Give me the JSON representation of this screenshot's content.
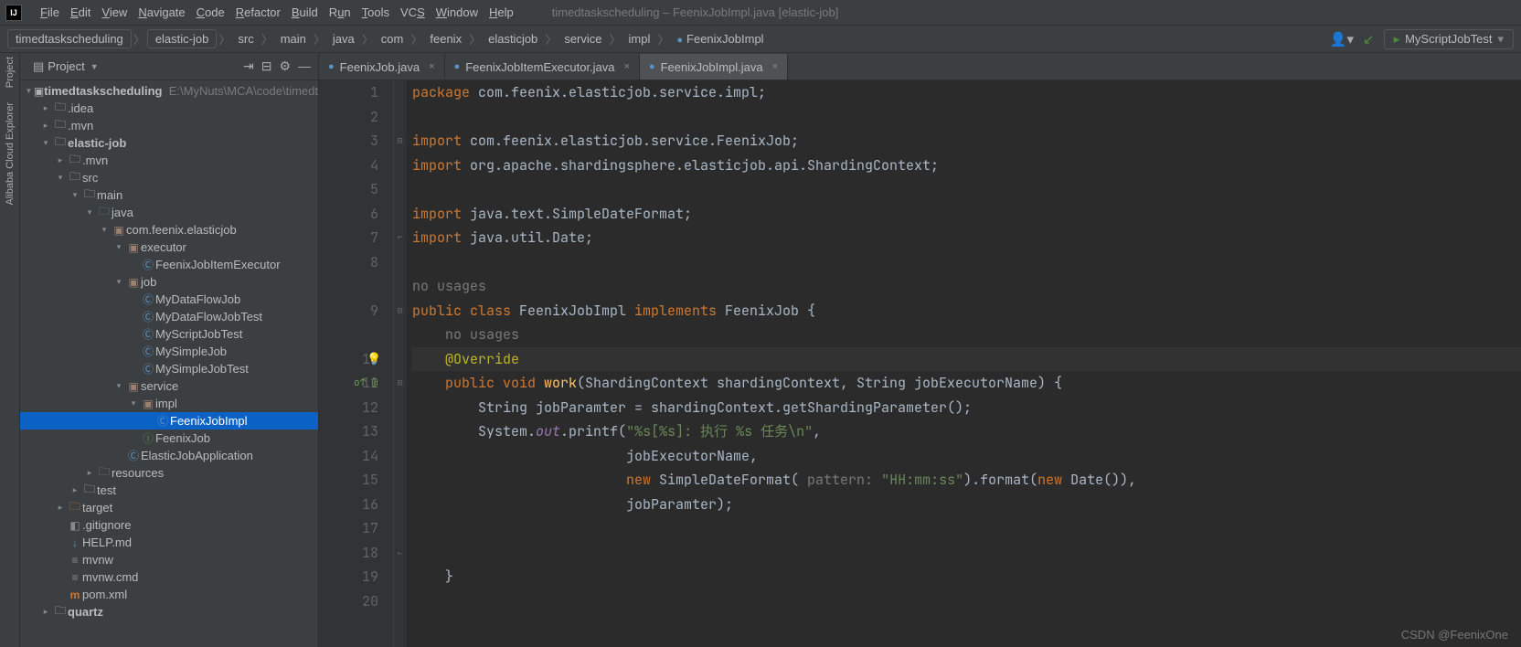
{
  "menubar": {
    "title": "timedtaskscheduling – FeenixJobImpl.java [elastic-job]",
    "items": [
      "File",
      "Edit",
      "View",
      "Navigate",
      "Code",
      "Refactor",
      "Build",
      "Run",
      "Tools",
      "VCS",
      "Window",
      "Help"
    ]
  },
  "breadcrumbs": {
    "items": [
      "timedtaskscheduling",
      "elastic-job",
      "src",
      "main",
      "java",
      "com",
      "feenix",
      "elasticjob",
      "service",
      "impl",
      "FeenixJobImpl"
    ],
    "run_config": "MyScriptJobTest"
  },
  "project_panel": {
    "title": "Project",
    "root": "timedtaskscheduling",
    "root_path": "E:\\MyNuts\\MCA\\code\\timedt",
    "tree": {
      "idea": ".idea",
      "mvn": ".mvn",
      "elastic_job": "elastic-job",
      "ej_mvn": ".mvn",
      "src": "src",
      "main": "main",
      "java": "java",
      "pkg": "com.feenix.elasticjob",
      "executor": "executor",
      "fjie": "FeenixJobItemExecutor",
      "job": "job",
      "mdfj": "MyDataFlowJob",
      "mdfjt": "MyDataFlowJobTest",
      "msjt": "MyScriptJobTest",
      "msj": "MySimpleJob",
      "msjt2": "MySimpleJobTest",
      "service": "service",
      "impl": "impl",
      "fjimpl": "FeenixJobImpl",
      "fj": "FeenixJob",
      "eja": "ElasticJobApplication",
      "res": "resources",
      "test": "test",
      "target": "target",
      "gitignore": ".gitignore",
      "help": "HELP.md",
      "mvnw": "mvnw",
      "mvnwcmd": "mvnw.cmd",
      "pom": "pom.xml",
      "quartz": "quartz"
    }
  },
  "sidebar": {
    "project": "Project",
    "explorer": "Alibaba Cloud Explorer"
  },
  "tabs": {
    "t1": "FeenixJob.java",
    "t2": "FeenixJobItemExecutor.java",
    "t3": "FeenixJobImpl.java"
  },
  "editor": {
    "line_numbers": [
      "1",
      "2",
      "3",
      "4",
      "5",
      "6",
      "7",
      "8",
      "",
      "9",
      "",
      "10",
      "11",
      "12",
      "13",
      "14",
      "15",
      "16",
      "17",
      "18",
      "19",
      "20"
    ],
    "usages_class": "no usages",
    "usages_method": "no usages",
    "l1_kw": "package ",
    "l1_rest": "com.feenix.elasticjob.service.impl;",
    "l3_kw": "import ",
    "l3_pkg_a": "com.feenix.elasticjob.service.FeenixJob;",
    "l4_kw": "import ",
    "l4_pkg": "org.apache.shardingsphere.elasticjob.api.ShardingContext;",
    "l6_kw": "import ",
    "l6_rest": "java.text.SimpleDateFormat;",
    "l7_kw": "import ",
    "l7_rest": "java.util.Date;",
    "l9a": "public class ",
    "l9b": "FeenixJobImpl ",
    "l9c": "implements ",
    "l9d": "FeenixJob {",
    "l10": "@Override",
    "l11a": "public void ",
    "l11m": "work",
    "l11p": "(ShardingContext shardingContext, String jobExecutorName) {",
    "l12": "String jobParamter = shardingContext.getShardingParameter();",
    "l13a": "System.",
    "l13out": "out",
    "l13b": ".printf(",
    "l13s": "\"%s[%s]: 执行 %s 任务\\n\"",
    "l13c": ",",
    "l14": "jobExecutorName,",
    "l15a": "new ",
    "l15b": "SimpleDateFormat( ",
    "l15h": "pattern: ",
    "l15s": "\"HH:mm:ss\"",
    "l15c": ").format(",
    "l15d": "new ",
    "l15e": "Date()),",
    "l16": "jobParamter);",
    "l19": "}"
  },
  "watermark": "CSDN @FeenixOne"
}
